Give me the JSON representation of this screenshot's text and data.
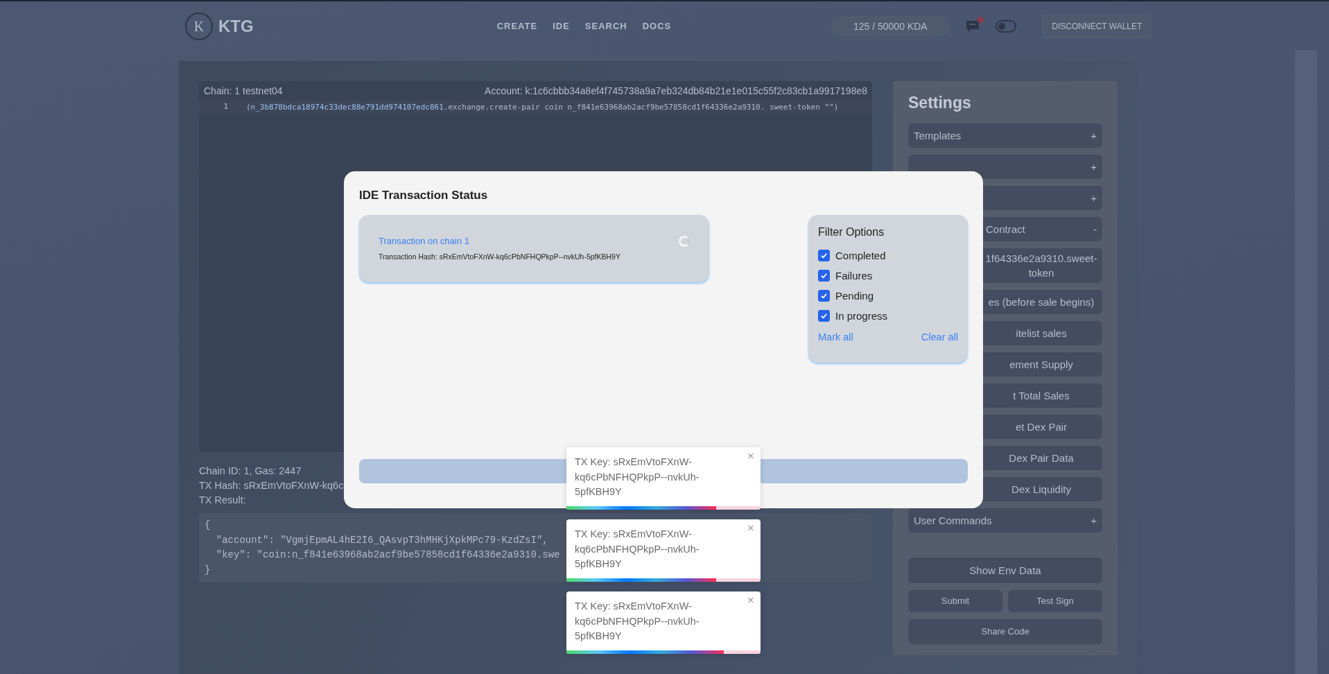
{
  "header": {
    "logo_letter": "K",
    "brand": "KTG",
    "nav": [
      {
        "label": "CREATE"
      },
      {
        "label": "IDE"
      },
      {
        "label": "SEARCH"
      },
      {
        "label": "DOCS"
      }
    ],
    "balance": "125 / 50000 KDA",
    "notification_badge": true,
    "theme_toggle_on": false,
    "disconnect_button": "DISCONNECT WALLET"
  },
  "editor": {
    "chain": "Chain: 1 testnet04",
    "account": "Account: k:1c6cbbb34a8ef4f745738a9a7eb324db84b21e1e015c55f2c83cb1a9917198e8",
    "lines": [
      {
        "number": "1",
        "segments": [
          {
            "kind": "namespace",
            "text": "(n_3b878bdca18974c33dec88e791dd974107edc861"
          },
          {
            "kind": "plain",
            "text": ".exchange.create-pair coin n_f841e63968ab2acf9be57858cd1f64336e2a9310. sweet-token \"\")"
          }
        ]
      }
    ]
  },
  "result": {
    "chain_gas": "Chain ID: 1, Gas: 2447",
    "tx_hash": "TX Hash: sRxEmVtoFXnW-kq6c",
    "label": "TX Result:",
    "json_lines": [
      "{",
      "  \"account\": \"VgmjEpmAL4hE2I6_QAsvpT3hMHKjXpkMPc79-KzdZsI\",",
      "  \"key\": \"coin:n_f841e63968ab2acf9be57858cd1f64336e2a9310.swe",
      "}"
    ]
  },
  "settings": {
    "title": "Settings",
    "items": [
      {
        "kind": "section",
        "label": "Templates",
        "sign": "+",
        "clipped": false
      },
      {
        "kind": "section",
        "sign": "+"
      },
      {
        "kind": "section",
        "sign": "+"
      },
      {
        "kind": "section",
        "label": "Contract",
        "sign": "-",
        "clipped": true
      },
      {
        "kind": "command",
        "label": "1f64336e2a9310.sweet-token",
        "clipped": true
      },
      {
        "kind": "command",
        "label": "es (before sale begins)",
        "clipped": true
      },
      {
        "kind": "command",
        "label": "itelist sales",
        "clipped": true
      },
      {
        "kind": "command",
        "label": "ement Supply",
        "clipped": true
      },
      {
        "kind": "command",
        "label": "t Total Sales",
        "clipped": true
      },
      {
        "kind": "command",
        "label": "et Dex Pair",
        "clipped": true
      },
      {
        "kind": "command",
        "label": "Dex Pair Data",
        "clipped": true
      },
      {
        "kind": "command",
        "label": "Dex Liquidity",
        "clipped": true
      },
      {
        "kind": "section",
        "label": "User Commands",
        "sign": "+",
        "clipped": false
      }
    ],
    "show_env": "Show Env Data",
    "submit": "Submit",
    "test_sign": "Test Sign",
    "share": "Share Code"
  },
  "modal": {
    "title": "IDE Transaction Status",
    "transactions": [
      {
        "title": "Transaction on chain 1",
        "hash": "Transaction Hash: sRxEmVtoFXnW-kq6cPbNFHQPkpP--nvkUh-5pfKBH9Y"
      }
    ],
    "filter": {
      "title": "Filter Options",
      "options": [
        {
          "label": "Completed",
          "checked": true
        },
        {
          "label": "Failures",
          "checked": true
        },
        {
          "label": "Pending",
          "checked": true
        },
        {
          "label": "In progress",
          "checked": true
        }
      ],
      "mark_all": "Mark all",
      "clear_all": "Clear all"
    }
  },
  "toasts": [
    {
      "text": "TX Key: sRxEmVtoFXnW-kq6cPbNFHQPkpP--nvkUh-5pfKBH9Y",
      "close": "×",
      "level": 0.77
    },
    {
      "text": "TX Key: sRxEmVtoFXnW-kq6cPbNFHQPkpP--nvkUh-5pfKBH9Y",
      "close": "×",
      "level": 0.77
    },
    {
      "text": "TX Key: sRxEmVtoFXnW-kq6cPbNFHQPkpP--nvkUh-5pfKBH9Y",
      "close": "×",
      "level": 0.81
    }
  ]
}
